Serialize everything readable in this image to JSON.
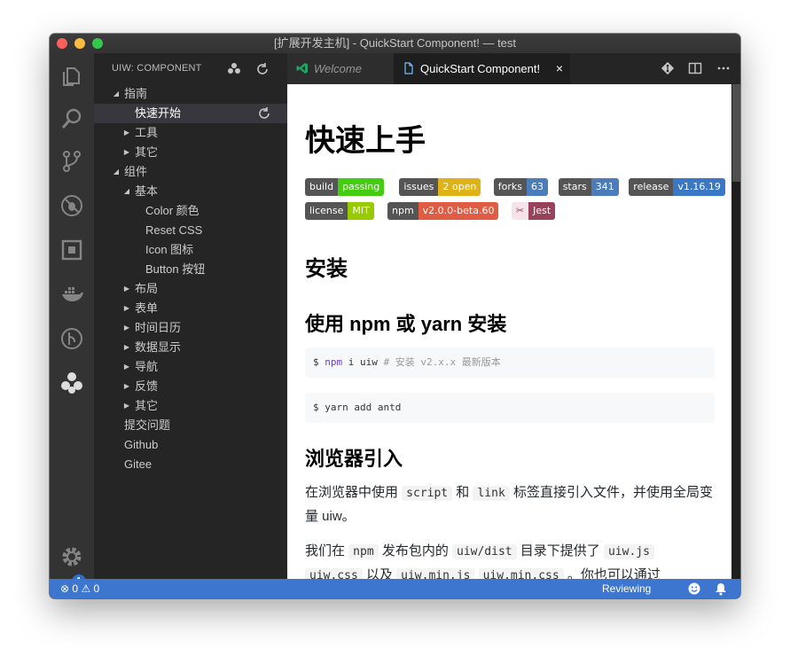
{
  "window": {
    "title": "[扩展开发主机] - QuickStart Component! — test"
  },
  "activity_bar": {
    "icons": [
      "files-icon",
      "search-icon",
      "source-control-icon",
      "debug-icon",
      "extensions-icon",
      "docker-icon",
      "gitlens-icon",
      "uiw-logo-icon",
      "settings-gear-icon"
    ],
    "badge_count": "1"
  },
  "sidebar": {
    "header": "UIW: COMPONENT",
    "tree": [
      {
        "label": "指南",
        "depth": 0,
        "twisty": "expanded"
      },
      {
        "label": "快速开始",
        "depth": 1,
        "twisty": "none",
        "selected": true
      },
      {
        "label": "工具",
        "depth": 1,
        "twisty": "collapsed"
      },
      {
        "label": "其它",
        "depth": 1,
        "twisty": "collapsed"
      },
      {
        "label": "组件",
        "depth": 0,
        "twisty": "expanded"
      },
      {
        "label": "基本",
        "depth": 1,
        "twisty": "expanded"
      },
      {
        "label": "Color 颜色",
        "depth": 2,
        "twisty": "none"
      },
      {
        "label": "Reset CSS",
        "depth": 2,
        "twisty": "none"
      },
      {
        "label": "Icon 图标",
        "depth": 2,
        "twisty": "none"
      },
      {
        "label": "Button 按钮",
        "depth": 2,
        "twisty": "none"
      },
      {
        "label": "布局",
        "depth": 1,
        "twisty": "collapsed"
      },
      {
        "label": "表单",
        "depth": 1,
        "twisty": "collapsed"
      },
      {
        "label": "时间日历",
        "depth": 1,
        "twisty": "collapsed"
      },
      {
        "label": "数据显示",
        "depth": 1,
        "twisty": "collapsed"
      },
      {
        "label": "导航",
        "depth": 1,
        "twisty": "collapsed"
      },
      {
        "label": "反馈",
        "depth": 1,
        "twisty": "collapsed"
      },
      {
        "label": "其它",
        "depth": 1,
        "twisty": "collapsed"
      },
      {
        "label": "提交问题",
        "depth": 0,
        "twisty": "none"
      },
      {
        "label": "Github",
        "depth": 0,
        "twisty": "none"
      },
      {
        "label": "Gitee",
        "depth": 0,
        "twisty": "none"
      }
    ]
  },
  "tabs": [
    {
      "label": "Welcome",
      "active": false
    },
    {
      "label": "QuickStart Component!",
      "active": true,
      "close": "×"
    }
  ],
  "doc": {
    "h1": "快速上手",
    "badges_row1": [
      {
        "left": "build",
        "right": "passing",
        "color": "#4c1"
      },
      {
        "left": "issues",
        "right": "2 open",
        "color": "#dfb317"
      },
      {
        "left": "forks",
        "right": "63",
        "color": "#4c7cba"
      },
      {
        "left": "stars",
        "right": "341",
        "color": "#4c7cba"
      },
      {
        "left": "release",
        "right": "v1.16.19",
        "color": "#3a78c5"
      }
    ],
    "badges_row2": [
      {
        "left": "license",
        "right": "MIT",
        "color": "#97ca00"
      },
      {
        "left": "npm",
        "right": "v2.0.0-beta.60",
        "color": "#e05d44"
      },
      {
        "left": "",
        "right": "Jest",
        "color": "#99425b"
      }
    ],
    "h2_install": "安装",
    "h3_npm": "使用 npm 或 yarn 安装",
    "code1": {
      "prompt": "$ ",
      "cmd": "npm",
      "rest": " i uiw ",
      "comment": "# 安装 v2.x.x 最新版本"
    },
    "code2": "$ yarn add antd",
    "h3_browser": "浏览器引入",
    "p1": {
      "a": "在浏览器中使用 ",
      "code1": "script",
      "b": " 和 ",
      "code2": "link",
      "c": " 标签直接引入文件，并使用全局变量 uiw。"
    },
    "p2": {
      "a": "我们在 ",
      "code1": "npm",
      "b": " 发布包内的 ",
      "code2": "uiw/dist",
      "c": " 目录下提供了 ",
      "code3": "uiw.js",
      "d": " ",
      "code4": "uiw.css",
      "e": " 以及 ",
      "code5": "uiw.min.js",
      "f": " ",
      "code6": "uiw.min.css",
      "g": " 。你也可以通过"
    }
  },
  "status_bar": {
    "errors": "0",
    "warnings": "0",
    "reviewing": "Reviewing"
  }
}
